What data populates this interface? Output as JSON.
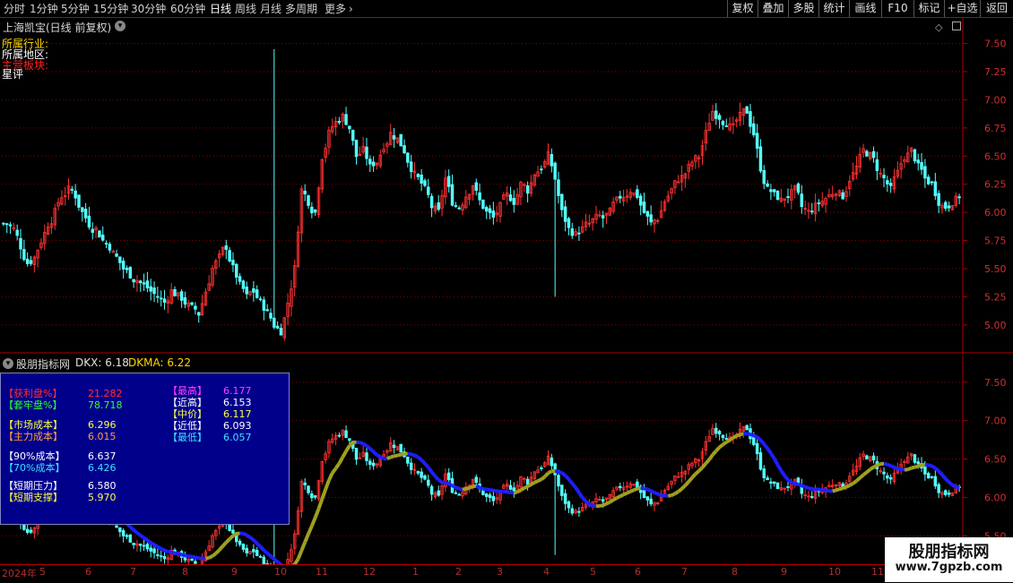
{
  "toolbar": {
    "periods": [
      "分时",
      "1分钟",
      "5分钟",
      "15分钟",
      "30分钟",
      "60分钟",
      "日线",
      "周线",
      "月线",
      "多周期",
      "更多"
    ],
    "active": "日线",
    "more_icon": "chevron-right-icon",
    "right_buttons": [
      "复权",
      "叠加",
      "多股",
      "统计",
      "画线",
      "F10",
      "标记",
      "+自选",
      "返回"
    ]
  },
  "main_chart": {
    "title": "上海凯宝(日线 前复权)",
    "info_lines": [
      "所属行业:",
      "所属地区:",
      "主营板块:",
      "星评"
    ],
    "y_ticks": [
      "7.50",
      "7.25",
      "7.00",
      "6.75",
      "6.50",
      "6.25",
      "6.00",
      "5.75",
      "5.50",
      "5.25",
      "5.00"
    ]
  },
  "indicator": {
    "name": "股朋指标网",
    "dkx_label": "DKX: 6.18",
    "dkma_label": "DKMA: 6.22",
    "y_ticks": [
      "7.50",
      "7.00",
      "6.50",
      "6.00",
      "5.50"
    ]
  },
  "overlay": {
    "left": [
      {
        "label": "【获利盘%】",
        "value": "21.282"
      },
      {
        "label": "【套牢盘%】",
        "value": "78.718"
      },
      {
        "label": "【市场成本】",
        "value": "6.296"
      },
      {
        "label": "【主力成本】",
        "value": "6.015"
      },
      {
        "label": "【90%成本】",
        "value": "6.637"
      },
      {
        "label": "【70%成本】",
        "value": "6.426"
      },
      {
        "label": "【短期压力】",
        "value": "6.580"
      },
      {
        "label": "【短期支撑】",
        "value": "5.970"
      }
    ],
    "right": [
      {
        "label": "【最高】",
        "value": "6.177"
      },
      {
        "label": "【近高】",
        "value": "6.153"
      },
      {
        "label": "【中价】",
        "value": "6.117"
      },
      {
        "label": "【近低】",
        "value": "6.093"
      },
      {
        "label": "【最低】",
        "value": "6.057"
      }
    ]
  },
  "time_axis": [
    "2024年",
    "5",
    "6",
    "7",
    "8",
    "9",
    "10",
    "11",
    "12",
    "1",
    "2",
    "3",
    "4",
    "5",
    "6",
    "7",
    "8",
    "9",
    "10",
    "11"
  ],
  "watermark": {
    "line1": "股朋指标网",
    "line2": "www.7gpzb.com"
  },
  "colors": {
    "up": "#ff3232",
    "down": "#54ffff",
    "dkx": "#1e1eff",
    "dkma": "#a0a020",
    "grid": "#8b0000",
    "axis": "#b00000"
  },
  "chart_data": {
    "type": "candlestick",
    "ylim": [
      4.8,
      7.6
    ],
    "close_series": [
      5.9,
      5.85,
      5.7,
      5.55,
      5.6,
      5.75,
      5.9,
      6.0,
      6.15,
      6.2,
      6.15,
      6.0,
      5.9,
      5.85,
      5.75,
      5.7,
      5.6,
      5.5,
      5.45,
      5.4,
      5.35,
      5.3,
      5.25,
      5.2,
      5.3,
      5.25,
      5.2,
      5.15,
      5.1,
      5.3,
      5.5,
      5.6,
      5.7,
      5.5,
      5.35,
      5.25,
      5.3,
      5.2,
      5.1,
      5.0,
      4.95,
      5.2,
      5.5,
      6.2,
      6.1,
      6.0,
      6.5,
      6.7,
      6.8,
      6.85,
      6.75,
      6.5,
      6.55,
      6.4,
      6.45,
      6.6,
      6.7,
      6.65,
      6.55,
      6.4,
      6.3,
      6.2,
      6.05,
      6.0,
      6.3,
      6.1,
      6.05,
      6.15,
      6.25,
      6.1,
      6.0,
      5.95,
      6.05,
      6.15,
      6.1,
      6.25,
      6.2,
      6.35,
      6.4,
      6.5,
      6.3,
      6.0,
      5.85,
      5.8,
      5.85,
      5.9,
      5.95,
      5.95,
      6.0,
      6.1,
      6.15,
      6.2,
      6.15,
      6.0,
      5.9,
      5.95,
      6.1,
      6.2,
      6.3,
      6.35,
      6.45,
      6.5,
      6.7,
      6.9,
      6.85,
      6.8,
      6.75,
      6.85,
      6.9,
      6.7,
      6.4,
      6.2,
      6.15,
      6.1,
      6.15,
      6.2,
      6.05,
      6.0,
      6.05,
      6.1,
      6.15,
      6.2,
      6.15,
      6.3,
      6.4,
      6.55,
      6.5,
      6.4,
      6.3,
      6.2,
      6.35,
      6.5,
      6.55,
      6.4,
      6.3,
      6.25,
      6.1,
      6.05,
      6.1,
      6.15
    ]
  }
}
